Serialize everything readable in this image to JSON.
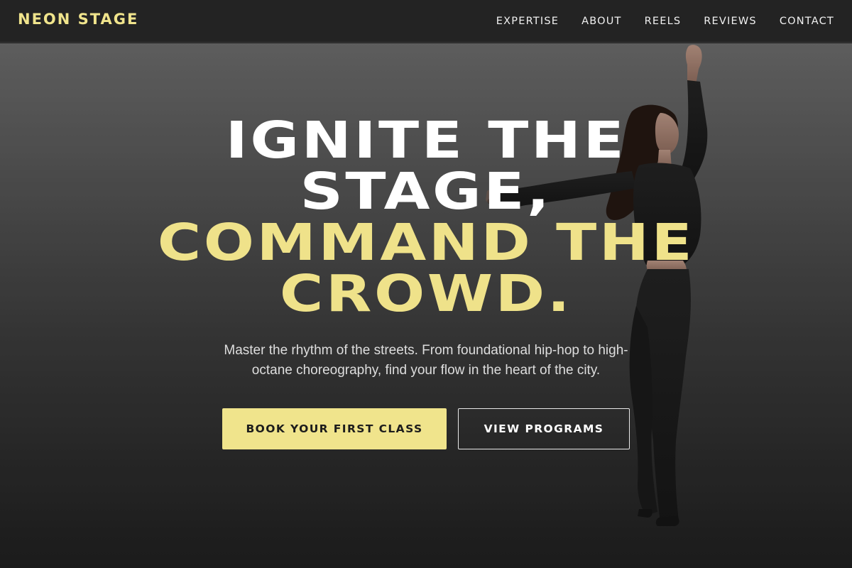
{
  "header": {
    "brand": "NEON STAGE",
    "nav": [
      {
        "label": "EXPERTISE"
      },
      {
        "label": "ABOUT"
      },
      {
        "label": "REELS"
      },
      {
        "label": "REVIEWS"
      },
      {
        "label": "CONTACT"
      }
    ]
  },
  "hero": {
    "headline_white": [
      "IGNITE THE",
      "STAGE,"
    ],
    "headline_yellow": [
      "COMMAND THE",
      "CROWD."
    ],
    "subtitle": [
      "Master the rhythm of the streets. From foundational hip-hop to high-",
      "octane choreography, find your flow in the heart of the city."
    ],
    "primary_cta": "BOOK YOUR FIRST CLASS",
    "secondary_cta": "VIEW PROGRAMS",
    "image": "dancer-photo"
  },
  "colors": {
    "accent": "#f0e48c",
    "header_bg": "#232323",
    "hero_top": "#6a6a6a",
    "hero_bottom": "#1f1f1f",
    "text_light": "#ffffff"
  }
}
